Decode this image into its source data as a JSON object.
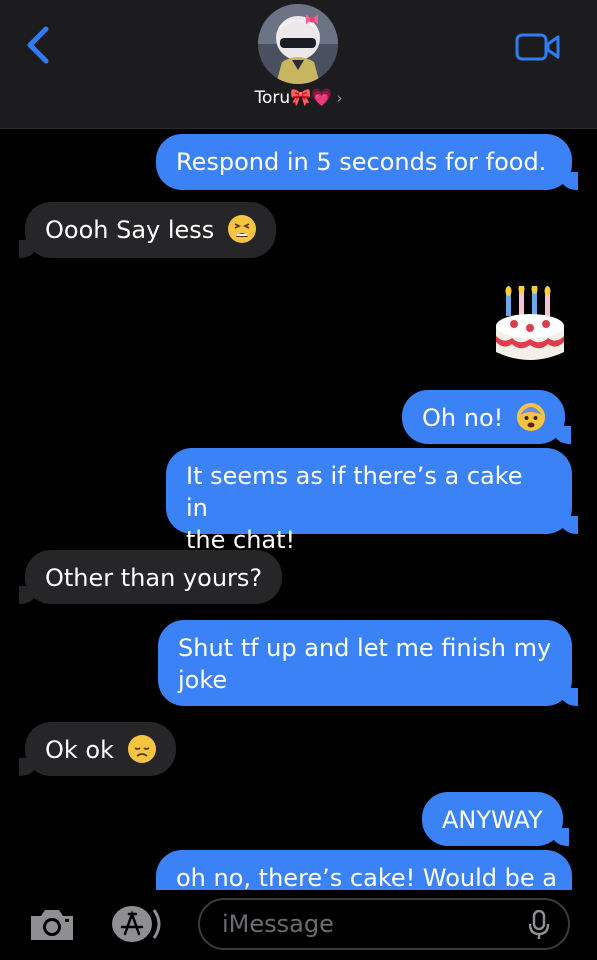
{
  "header": {
    "contact_name": "Toru🎀💗",
    "chevron": "›"
  },
  "messages": [
    {
      "from": "me",
      "text": "Respond in 5 seconds for food."
    },
    {
      "from": "them",
      "text": "Oooh Say less",
      "emoji": "tired-face-icon"
    },
    {
      "from": "me",
      "type": "emoji",
      "emoji": "birthday-cake-icon"
    },
    {
      "from": "me",
      "text": "Oh no!",
      "emoji": "fearful-face-icon"
    },
    {
      "from": "me",
      "lines": [
        "It seems as if there’s a cake in",
        "the chat!"
      ]
    },
    {
      "from": "them",
      "text": "Other than yours?"
    },
    {
      "from": "me",
      "lines": [
        "Shut tf up and let me finish my",
        "joke"
      ]
    },
    {
      "from": "them",
      "text": "Ok ok",
      "emoji": "disappointed-face-icon"
    },
    {
      "from": "me",
      "text": "ANYWAY"
    },
    {
      "from": "me",
      "text": "oh no, there’s cake! Would be a"
    }
  ],
  "composer": {
    "placeholder": "iMessage"
  },
  "colors": {
    "sent_bubble": "#3b82f6",
    "received_bubble": "#262628",
    "accent": "#2f7cf6",
    "header_bg": "#1c1c1e"
  }
}
